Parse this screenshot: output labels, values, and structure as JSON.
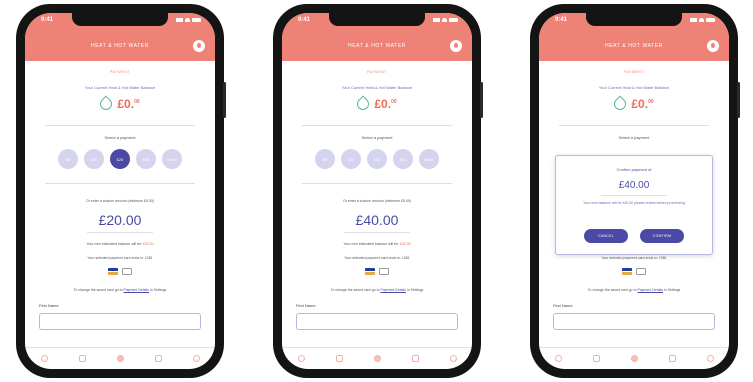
{
  "phones": [
    {
      "time": "9:41",
      "app_title": "HEAT & HOT WATER",
      "section": "PAYMENT",
      "balance_label": "Your Current Heat & Hot Water Balance",
      "balance_main": "£0.",
      "balance_sup": "00",
      "select_label": "Select a payment",
      "amounts": [
        "£5",
        "£10",
        "£20",
        "£40",
        "Other"
      ],
      "selected_index": 2,
      "note": "Or enter a custom amount (minimum £5.00)",
      "big_amount": "£20.00",
      "est_prefix": "Your new estimated balance will be:",
      "est_value": "£20.00",
      "method": "Your selected payment card ends in: 1081",
      "change_prefix": "To change the saved card go to",
      "change_link": "Payment Details",
      "change_suffix": "in Settings",
      "first_name_label": "First Name"
    },
    {
      "time": "9:41",
      "app_title": "HEAT & HOT WATER",
      "section": "PAYMENT",
      "balance_label": "Your Current Heat & Hot Water Balance",
      "balance_main": "£0.",
      "balance_sup": "00",
      "select_label": "Select a payment",
      "amounts": [
        "£5",
        "£10",
        "£20",
        "£40",
        "Other"
      ],
      "selected_index": -1,
      "note": "Or enter a custom amount (minimum £5.00)",
      "big_amount": "£40.00",
      "est_prefix": "Your new estimated balance will be:",
      "est_value": "£40.00",
      "method": "Your selected payment card ends in: 1081",
      "change_prefix": "To change the saved card go to",
      "change_link": "Payment Details",
      "change_suffix": "in Settings",
      "first_name_label": "First Name"
    },
    {
      "time": "9:41",
      "app_title": "HEAT & HOT WATER",
      "section": "PAYMENT",
      "balance_label": "Your Current Heat & Hot Water Balance",
      "balance_main": "£0.",
      "balance_sup": "00",
      "select_label": "Select a payment",
      "method": "Your selected payment card ends in: 1081",
      "change_prefix": "To change the saved card go to",
      "change_link": "Payment Details",
      "change_suffix": "in Settings",
      "first_name_label": "First Name",
      "dialog": {
        "title": "Confirm payment of",
        "amount": "£40.00",
        "message": "Your new balance will be £40.00 please review before proceeding",
        "cancel_label": "CANCEL",
        "confirm_label": "CONFIRM"
      }
    }
  ],
  "colors": {
    "header": "#ef8276",
    "accent_purple": "#4a4aa6",
    "amount_red": "#ef6b5a",
    "unselected_amount": "#d5d4ee"
  }
}
